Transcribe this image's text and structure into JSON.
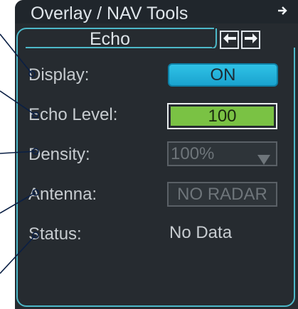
{
  "header": {
    "title": "Overlay / NAV Tools",
    "corner_icon": "right-arrow-icon"
  },
  "tab": {
    "label": "Echo",
    "prev_icon": "left-arrow-icon",
    "next_icon": "right-arrow-icon"
  },
  "settings": {
    "display_label": "Display:",
    "display_value": "ON",
    "echo_level_label": "Echo Level:",
    "echo_level_value": "100",
    "echo_level_fraction": 1.0,
    "density_label": "Density:",
    "density_value": "100%",
    "antenna_label": "Antenna:",
    "antenna_value": "NO RADAR",
    "status_label": "Status:",
    "status_value": "No Data"
  },
  "colors": {
    "panel_bg": "#262b30",
    "accent": "#4db9c9",
    "on_button": "#1fb0d9",
    "level_fill": "#7ac244",
    "disabled_text": "#6e757a"
  }
}
